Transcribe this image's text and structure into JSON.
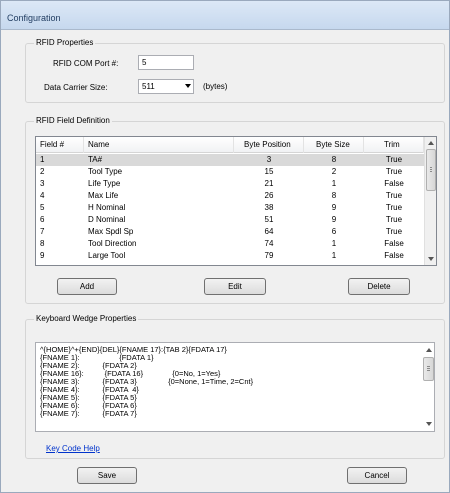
{
  "window": {
    "title": "Configuration"
  },
  "rfid_properties": {
    "group_label": "RFID Properties",
    "com_port_label": "RFID COM Port #:",
    "com_port_value": "5",
    "carrier_size_label": "Data Carrier Size:",
    "carrier_size_value": "511",
    "carrier_size_unit": "(bytes)"
  },
  "field_definition": {
    "group_label": "RFID Field Definition",
    "columns": [
      "Field #",
      "Name",
      "Byte Position",
      "Byte Size",
      "Trim"
    ],
    "rows": [
      [
        "1",
        "TA#",
        "3",
        "8",
        "True"
      ],
      [
        "2",
        "Tool Type",
        "15",
        "2",
        "True"
      ],
      [
        "3",
        "Life Type",
        "21",
        "1",
        "False"
      ],
      [
        "4",
        "Max Life",
        "26",
        "8",
        "True"
      ],
      [
        "5",
        "H Nominal",
        "38",
        "9",
        "True"
      ],
      [
        "6",
        "D Nominal",
        "51",
        "9",
        "True"
      ],
      [
        "7",
        "Max Spdl Sp",
        "64",
        "6",
        "True"
      ],
      [
        "8",
        "Tool Direction",
        "74",
        "1",
        "False"
      ],
      [
        "9",
        "Large Tool",
        "79",
        "1",
        "False"
      ]
    ],
    "selected_row": 0,
    "add_label": "Add",
    "edit_label": "Edit",
    "delete_label": "Delete"
  },
  "keyboard_wedge": {
    "group_label": "Keyboard Wedge Properties",
    "lines": [
      "^{HOME}^+{END}{DEL}{FNAME 17}:{TAB 2}{FDATA 17}",
      "{FNAME 1}:                   {FDATA 1}",
      "{FNAME 2}:           {FDATA 2}",
      "{FNAME 16}:          {FDATA 16}              {0=No, 1=Yes}",
      "{FNAME 3}:           {FDATA 3}               {0=None, 1=Time, 2=Cnt}",
      "{FNAME 4}:           {FDATA  4}",
      "{FNAME 5}:           {FDATA 5}",
      "{FNAME 6}:           {FDATA 6}",
      "{FNAME 7}:           {FDATA 7}"
    ],
    "help_link": "Key Code Help"
  },
  "footer": {
    "save_label": "Save",
    "cancel_label": "Cancel"
  }
}
